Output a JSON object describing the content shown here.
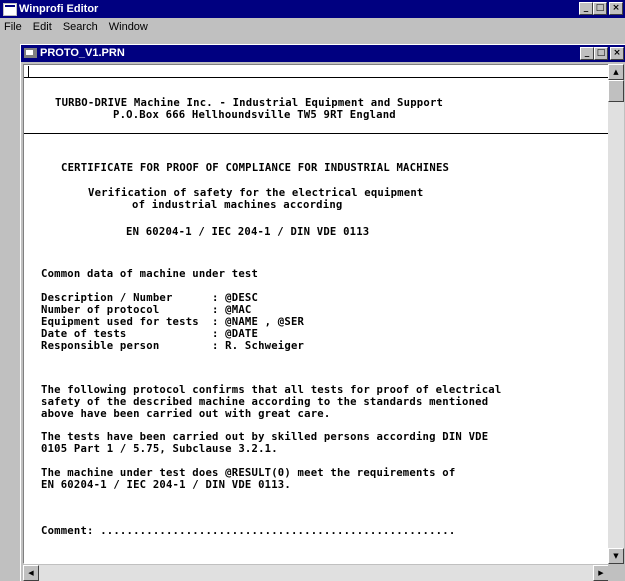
{
  "app": {
    "title": "Winprofi Editor",
    "menu": [
      "File",
      "Edit",
      "Search",
      "Window"
    ]
  },
  "document_window": {
    "title": "PROTO_V1.PRN"
  },
  "document": {
    "lines": [
      {
        "text": "TURBO-DRIVE Machine Inc. - Industrial Equipment and Support"
      },
      {
        "text": "P.O.Box 666 Hellhoundsville TW5 9RT England"
      },
      {
        "text": "CERTIFICATE FOR PROOF OF COMPLIANCE FOR INDUSTRIAL MACHINES"
      },
      {
        "text": "Verification of safety for the electrical equipment"
      },
      {
        "text": "of industrial machines according"
      },
      {
        "text": "EN 60204-1 / IEC 204-1 / DIN VDE 0113"
      },
      {
        "text": "Common data of machine under test"
      },
      {
        "text": "Description / Number      : @DESC"
      },
      {
        "text": "Number of protocol        : @MAC"
      },
      {
        "text": "Equipment used for tests  : @NAME , @SER"
      },
      {
        "text": "Date of tests             : @DATE"
      },
      {
        "text": "Responsible person        : R. Schweiger"
      },
      {
        "text": "The following protocol confirms that all tests for proof of electrical"
      },
      {
        "text": "safety of the described machine according to the standards mentioned"
      },
      {
        "text": "above have been carried out with great care."
      },
      {
        "text": "The tests have been carried out by skilled persons according DIN VDE"
      },
      {
        "text": "0105 Part 1 / 5.75, Subclause 3.2.1."
      },
      {
        "text": "The machine under test does @RESULT(0) meet the requirements of"
      },
      {
        "text": "EN 60204-1 / IEC 204-1 / DIN VDE 0113."
      },
      {
        "text": "Comment: ......................................................"
      }
    ]
  },
  "icons": {
    "minimize": "minimize-icon",
    "maximize": "maximize-icon",
    "close": "close-icon"
  }
}
